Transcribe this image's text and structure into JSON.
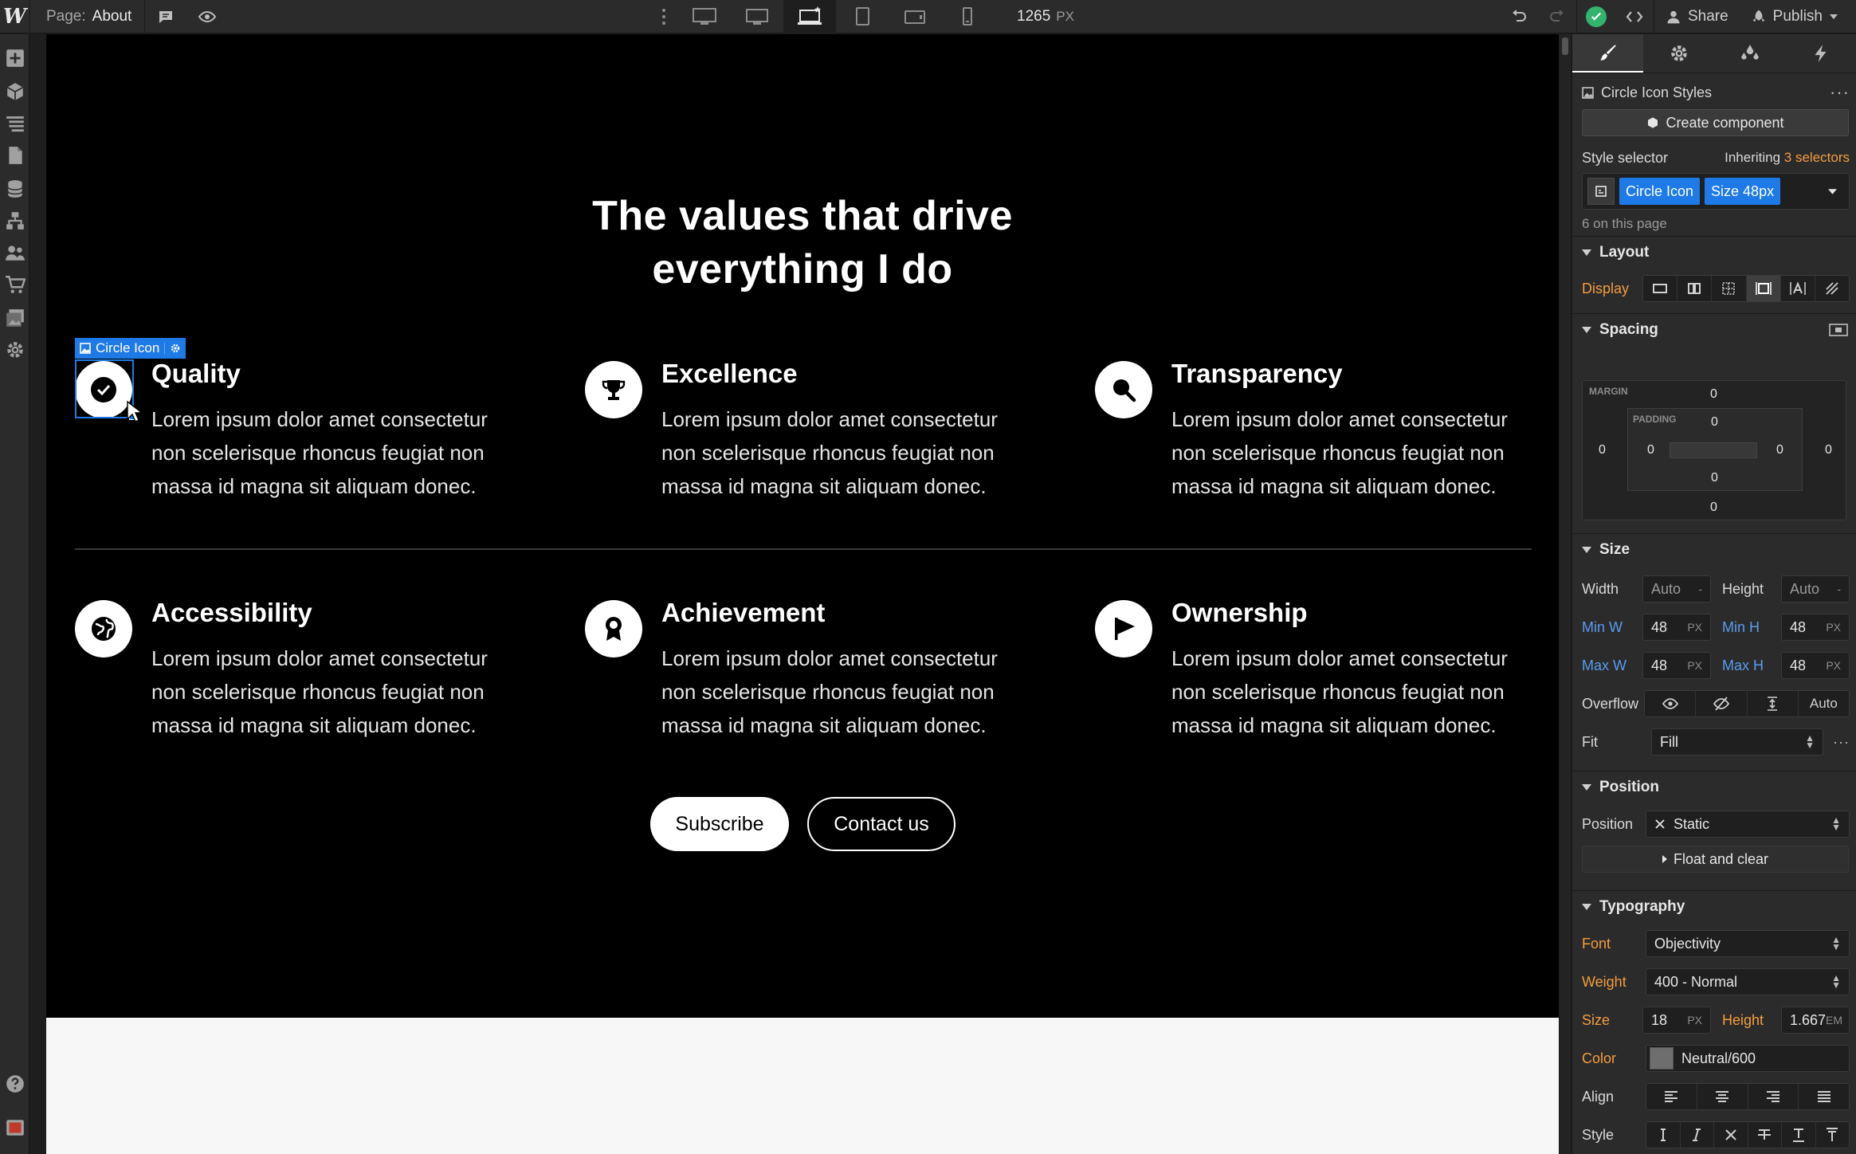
{
  "topbar": {
    "logo": "W",
    "page_key": "Page:",
    "page_value": "About",
    "canvas_width": "1265",
    "canvas_unit": "PX",
    "share_label": "Share",
    "publish_label": "Publish"
  },
  "canvas": {
    "title_line1": "The values that drive",
    "title_line2": "everything I do",
    "values": [
      {
        "title": "Quality",
        "desc": "Lorem ipsum dolor amet consectetur non scelerisque rhoncus feugiat non massa id magna sit aliquam donec.",
        "icon": "check-icon"
      },
      {
        "title": "Excellence",
        "desc": "Lorem ipsum dolor amet consectetur non scelerisque rhoncus feugiat non massa id magna sit aliquam donec.",
        "icon": "trophy-icon"
      },
      {
        "title": "Transparency",
        "desc": "Lorem ipsum dolor amet consectetur non scelerisque rhoncus feugiat non massa id magna sit aliquam donec.",
        "icon": "magnifier-icon"
      },
      {
        "title": "Accessibility",
        "desc": "Lorem ipsum dolor amet consectetur non scelerisque rhoncus feugiat non massa id magna sit aliquam donec.",
        "icon": "globe-icon"
      },
      {
        "title": "Achievement",
        "desc": "Lorem ipsum dolor amet consectetur non scelerisque rhoncus feugiat non massa id magna sit aliquam donec.",
        "icon": "medal-icon"
      },
      {
        "title": "Ownership",
        "desc": "Lorem ipsum dolor amet consectetur non scelerisque rhoncus feugiat non massa id magna sit aliquam donec.",
        "icon": "flag-icon"
      }
    ],
    "primary_button": "Subscribe",
    "secondary_button": "Contact us",
    "selection_tag": "Circle Icon"
  },
  "panel": {
    "element_name": "Circle Icon Styles",
    "create_component": "Create component",
    "style_selector_label": "Style selector",
    "inheriting_prefix": "Inheriting",
    "inheriting_link": "3 selectors",
    "chip1": "Circle Icon",
    "chip2": "Size 48px",
    "on_page": "6 on this page",
    "layout": {
      "heading": "Layout",
      "display_label": "Display"
    },
    "spacing": {
      "heading": "Spacing",
      "margin_label": "MARGIN",
      "padding_label": "PADDING",
      "margin_top": "0",
      "margin_right": "0",
      "margin_bottom": "0",
      "margin_left": "0",
      "padding_top": "0",
      "padding_right": "0",
      "padding_bottom": "0",
      "padding_left": "0"
    },
    "size": {
      "heading": "Size",
      "width_label": "Width",
      "width_val": "Auto",
      "height_label": "Height",
      "height_val": "Auto",
      "dash": "-",
      "minw_label": "Min W",
      "minw_val": "48",
      "minh_label": "Min H",
      "minh_val": "48",
      "maxw_label": "Max W",
      "maxw_val": "48",
      "maxh_label": "Max H",
      "maxh_val": "48",
      "unit": "PX",
      "overflow_label": "Overflow",
      "overflow_auto": "Auto",
      "fit_label": "Fit",
      "fit_val": "Fill"
    },
    "position": {
      "heading": "Position",
      "label": "Position",
      "value": "Static",
      "float_clear": "Float and clear"
    },
    "typography": {
      "heading": "Typography",
      "font_label": "Font",
      "font_val": "Objectivity",
      "weight_label": "Weight",
      "weight_val": "400 - Normal",
      "size_label": "Size",
      "size_val": "18",
      "size_unit": "PX",
      "height_label": "Height",
      "height_val": "1.667",
      "height_unit": "EM",
      "color_label": "Color",
      "color_val": "Neutral/600",
      "align_label": "Align",
      "style_label": "Style"
    }
  },
  "colors": {
    "accent": "#1e7ae6",
    "orange": "#f49d3f",
    "success": "#33b46e"
  }
}
